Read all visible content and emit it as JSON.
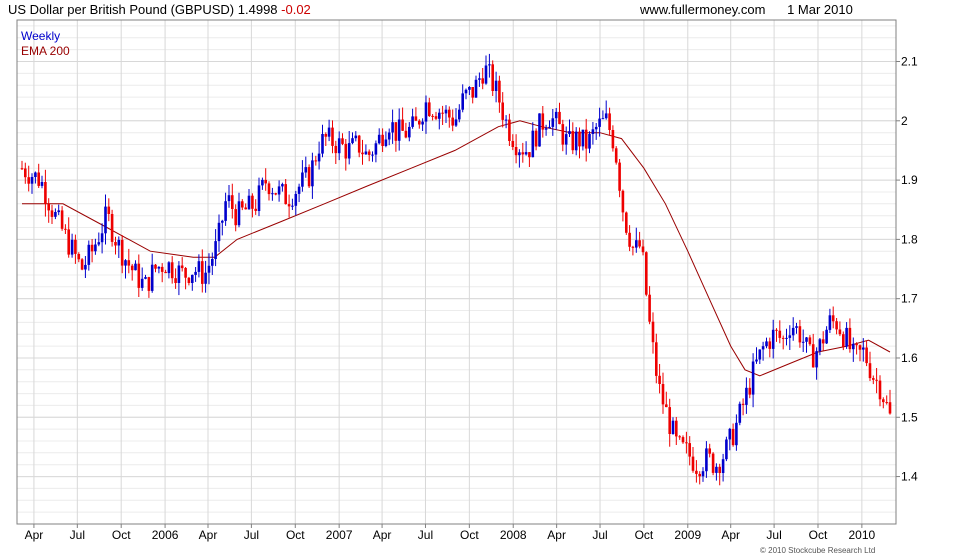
{
  "header": {
    "title": "US Dollar per British Pound (GBPUSD)",
    "price": "1.4998",
    "change": "-0.02",
    "site": "www.fullermoney.com",
    "date": "1 Mar 2010"
  },
  "legend": {
    "frequency": "Weekly",
    "ema": "EMA 200"
  },
  "copyright": "© 2010 Stockcube Research Ltd",
  "colors": {
    "up": "#0000cc",
    "down": "#ee0000",
    "ema": "#990000",
    "grid": "#d8d8d8",
    "frame": "#808080"
  },
  "chart_data": {
    "type": "line",
    "title": "US Dollar per British Pound (GBPUSD)",
    "y_axis_side": "right",
    "ylim": [
      1.32,
      2.17
    ],
    "y_ticks": [
      "1.4",
      "1.5",
      "1.6",
      "1.7",
      "1.8",
      "1.9",
      "2",
      "2.1"
    ],
    "x_ticks": [
      "Apr",
      "Jul",
      "Oct",
      "2006",
      "Apr",
      "Jul",
      "Oct",
      "2007",
      "Apr",
      "Jul",
      "Oct",
      "2008",
      "Apr",
      "Jul",
      "Oct",
      "2009",
      "Apr",
      "Jul",
      "Oct",
      "2010"
    ],
    "x_tick_dates": [
      "2005-04-01",
      "2005-07-01",
      "2005-10-01",
      "2006-01-01",
      "2006-04-01",
      "2006-07-01",
      "2006-10-01",
      "2007-01-01",
      "2007-04-01",
      "2007-07-01",
      "2007-10-01",
      "2008-01-01",
      "2008-04-01",
      "2008-07-01",
      "2008-10-01",
      "2009-01-01",
      "2009-04-01",
      "2009-07-01",
      "2009-10-01",
      "2010-01-01"
    ],
    "x_range": [
      "2005-03-07",
      "2010-03-01"
    ],
    "grid": true,
    "legend_position": "top-left",
    "series": [
      {
        "name": "Weekly",
        "style": "candles",
        "date": [
          "2005-03-07",
          "2005-04-15",
          "2005-05-15",
          "2005-06-15",
          "2005-07-10",
          "2005-08-01",
          "2005-09-01",
          "2005-09-25",
          "2005-10-15",
          "2005-11-01",
          "2005-11-20",
          "2005-12-10",
          "2006-01-01",
          "2006-01-20",
          "2006-02-10",
          "2006-03-01",
          "2006-03-25",
          "2006-04-20",
          "2006-05-10",
          "2006-06-01",
          "2006-06-20",
          "2006-07-10",
          "2006-08-01",
          "2006-08-25",
          "2006-09-15",
          "2006-10-10",
          "2006-11-01",
          "2006-11-20",
          "2006-12-05",
          "2006-12-31",
          "2007-01-20",
          "2007-02-10",
          "2007-03-01",
          "2007-03-20",
          "2007-04-15",
          "2007-05-01",
          "2007-05-20",
          "2007-06-10",
          "2007-07-01",
          "2007-07-25",
          "2007-08-15",
          "2007-09-01",
          "2007-09-20",
          "2007-10-10",
          "2007-11-01",
          "2007-11-15",
          "2007-12-01",
          "2007-12-20",
          "2008-01-10",
          "2008-02-01",
          "2008-02-25",
          "2008-03-15",
          "2008-04-05",
          "2008-04-25",
          "2008-05-15",
          "2008-06-05",
          "2008-06-25",
          "2008-07-15",
          "2008-08-01",
          "2008-08-20",
          "2008-09-10",
          "2008-09-25",
          "2008-10-15",
          "2008-11-01",
          "2008-11-20",
          "2008-12-10",
          "2008-12-31",
          "2009-01-20",
          "2009-02-10",
          "2009-03-01",
          "2009-03-20",
          "2009-04-10",
          "2009-05-01",
          "2009-05-20",
          "2009-06-10",
          "2009-07-01",
          "2009-07-20",
          "2009-08-05",
          "2009-08-25",
          "2009-09-15",
          "2009-10-05",
          "2009-10-25",
          "2009-11-10",
          "2009-11-30",
          "2009-12-15",
          "2010-01-05",
          "2010-01-25",
          "2010-02-10",
          "2010-03-01"
        ],
        "value": [
          1.92,
          1.9,
          1.84,
          1.79,
          1.75,
          1.78,
          1.84,
          1.79,
          1.76,
          1.74,
          1.72,
          1.75,
          1.76,
          1.75,
          1.74,
          1.75,
          1.74,
          1.79,
          1.87,
          1.84,
          1.85,
          1.86,
          1.9,
          1.88,
          1.87,
          1.89,
          1.91,
          1.96,
          1.97,
          1.96,
          1.95,
          1.96,
          1.94,
          1.96,
          2.0,
          1.98,
          1.98,
          1.99,
          2.03,
          2.02,
          2.01,
          2.0,
          2.04,
          2.05,
          2.09,
          2.07,
          2.04,
          1.99,
          1.96,
          1.95,
          1.99,
          2.01,
          1.99,
          1.96,
          1.97,
          1.96,
          1.99,
          2.0,
          1.96,
          1.84,
          1.78,
          1.79,
          1.64,
          1.55,
          1.5,
          1.45,
          1.44,
          1.42,
          1.43,
          1.42,
          1.44,
          1.48,
          1.53,
          1.58,
          1.62,
          1.64,
          1.63,
          1.66,
          1.64,
          1.6,
          1.62,
          1.66,
          1.66,
          1.63,
          1.6,
          1.61,
          1.57,
          1.55,
          1.5
        ]
      },
      {
        "name": "EMA 200",
        "style": "line",
        "date": [
          "2005-03-07",
          "2005-06-01",
          "2005-09-01",
          "2005-12-01",
          "2006-03-01",
          "2006-04-15",
          "2006-06-01",
          "2006-09-01",
          "2006-12-01",
          "2007-03-01",
          "2007-06-01",
          "2007-09-01",
          "2007-12-01",
          "2008-01-15",
          "2008-03-01",
          "2008-05-01",
          "2008-07-01",
          "2008-08-15",
          "2008-10-01",
          "2008-11-15",
          "2009-01-01",
          "2009-02-15",
          "2009-04-01",
          "2009-05-01",
          "2009-06-01",
          "2009-08-01",
          "2009-10-01",
          "2009-12-01",
          "2010-01-15",
          "2010-03-01"
        ],
        "value": [
          1.86,
          1.86,
          1.82,
          1.78,
          1.77,
          1.77,
          1.8,
          1.83,
          1.86,
          1.89,
          1.92,
          1.95,
          1.99,
          2.0,
          1.99,
          1.98,
          1.98,
          1.97,
          1.92,
          1.86,
          1.78,
          1.7,
          1.62,
          1.58,
          1.57,
          1.59,
          1.61,
          1.62,
          1.63,
          1.61
        ]
      }
    ]
  }
}
